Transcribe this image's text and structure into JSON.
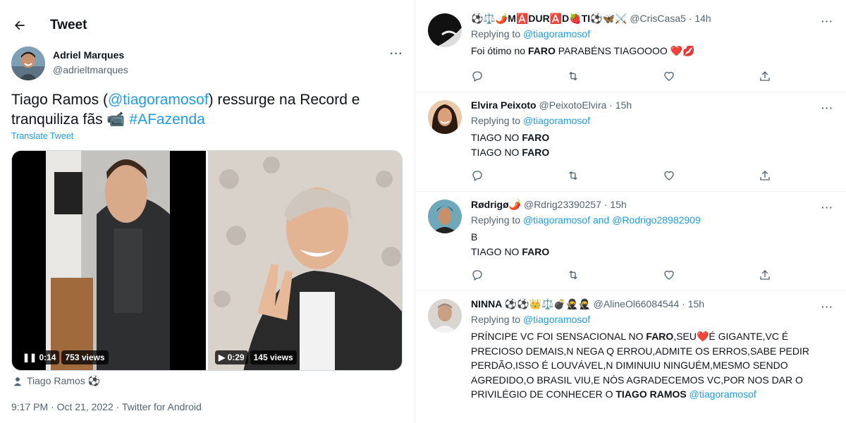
{
  "header": {
    "back_icon": "arrow-left-icon",
    "title": "Tweet"
  },
  "tweet": {
    "author_name": "Adriel Marques",
    "author_handle": "@adrieltmarques",
    "more_icon": "more-dots-icon",
    "text_part1": "Tiago Ramos (",
    "mention": "@tiagoramosof",
    "text_part2": ") ressurge na Record e tranquiliza fãs ",
    "emoji": "📹",
    "hashtag": "#AFazenda",
    "translate": "Translate Tweet",
    "video1_time": "0:14",
    "video1_views": "753 views",
    "video1_icon": "pause-icon",
    "video2_time": "0:29",
    "video2_views": "145 views",
    "video2_icon": "play-icon",
    "tagged_user": "Tiago Ramos ⚽",
    "meta": "9:17 PM · Oct 21, 2022 · Twitter for Android"
  },
  "replies": [
    {
      "name": "⚽⚖️🌶️M🅰️DUR🅰️D🍓TI⚽🦋⚔️",
      "handle": "@CrisCasa5",
      "time": "14h",
      "replying_prefix": "Replying to ",
      "replying_to": "@tiagoramosof",
      "body_pre": "Foi ótimo no ",
      "body_bold": "FARO",
      "body_post": " PARABÉNS TIAGOOOO ❤️💋"
    },
    {
      "name": "Elvira Peixoto",
      "handle": "@PeixotoElvira",
      "time": "15h",
      "replying_prefix": "Replying to ",
      "replying_to": "@tiagoramosof",
      "line1_pre": "TIAGO NO ",
      "line1_bold": "FARO",
      "line2_pre": "TIAGO NO ",
      "line2_bold": "FARO"
    },
    {
      "name": "Rødrigø🌶️",
      "handle": "@Rdrig23390257",
      "time": "15h",
      "replying_prefix": "Replying to ",
      "replying_to": "@tiagoramosof and @Rodrigo28982909",
      "line1": "B",
      "line2_pre": "TIAGO NO ",
      "line2_bold": "FARO"
    },
    {
      "name": "NINNA ⚽⚽👑⚖️💣🥷🥷",
      "handle": "@AlineOl66084544",
      "time": "15h",
      "replying_prefix": "Replying to ",
      "replying_to": "@tiagoramosof",
      "body_pre": "PRÍNCIPE VC FOI SENSACIONAL NO ",
      "body_bold1": "FARO",
      "body_mid": ",SEU❤️É GIGANTE,VC É PRECIOSO DEMAIS,N NEGA Q ERROU,ADMITE OS ERROS,SABE PEDIR PERDÃO,ISSO É LOUVÁVEL,N DIMINUIU NINGUÉM,MESMO SENDO AGREDIDO,O BRASIL VIU,E NÓS AGRADECEMOS VC,POR NOS DAR O PRIVILÉGIO DE CONHECER O ",
      "body_bold2": "TIAGO RAMOS",
      "body_mention": " @tiagoramosof"
    }
  ],
  "action_icons": [
    "reply-icon",
    "retweet-icon",
    "like-icon",
    "share-icon"
  ],
  "colors": {
    "link": "#1d9bf0",
    "secondary_text": "#536471",
    "primary_text": "#0f1419"
  }
}
